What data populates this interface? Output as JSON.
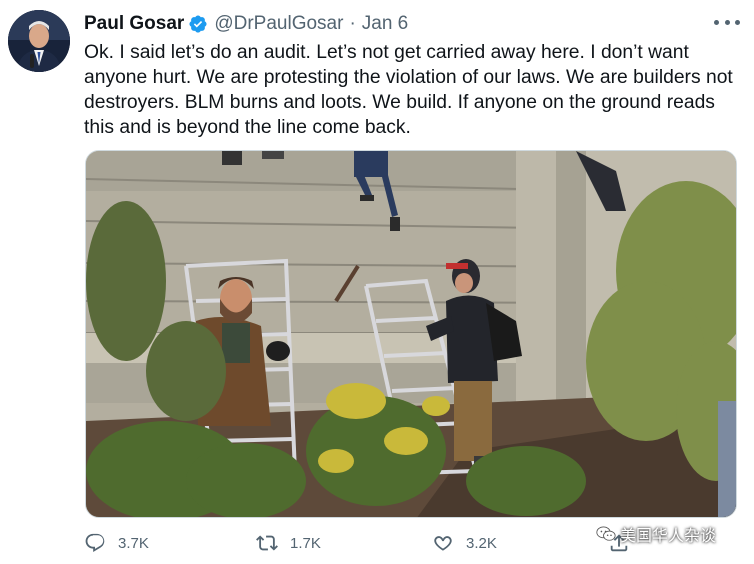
{
  "author": {
    "name": "Paul Gosar",
    "handle": "@DrPaulGosar",
    "separator": "·",
    "date": "Jan 6",
    "verified": true
  },
  "tweet": {
    "text": "Ok.  I said let’s do an audit.  Let’s not get carried away here.  I don’t want anyone hurt.  We are protesting the violation of our laws.  We are builders not destroyers.  BLM burns and loots.  We build.  If anyone on the ground reads this and is beyond the line come back."
  },
  "actions": {
    "replies": "3.7K",
    "retweets": "1.7K",
    "likes": "3.2K"
  },
  "watermark": "美国华人杂谈",
  "colors": {
    "verified": "#1d9bf0",
    "text": "#0f1419",
    "muted": "#536471"
  },
  "icons": [
    "verified-badge-icon",
    "more-options-icon",
    "reply-icon",
    "retweet-icon",
    "like-icon",
    "share-icon",
    "wechat-icon"
  ]
}
